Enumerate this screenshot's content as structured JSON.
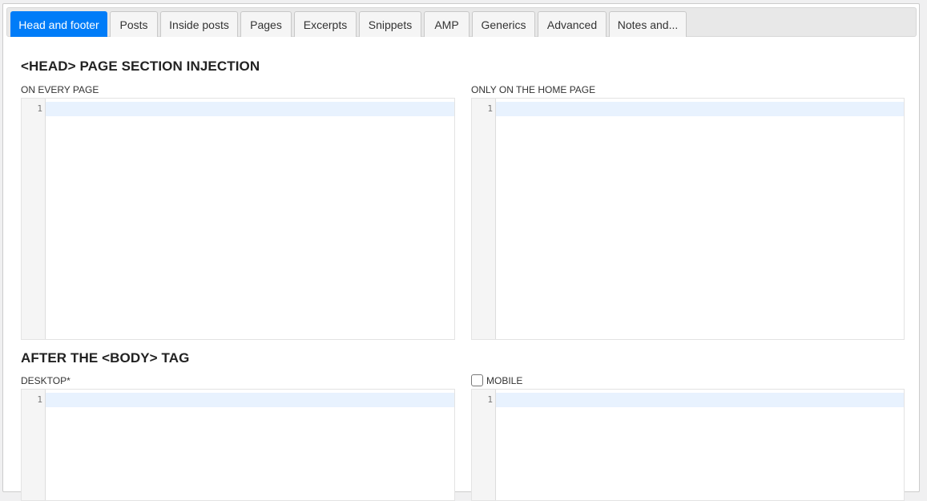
{
  "tabs": [
    {
      "label": "Head and footer",
      "active": true
    },
    {
      "label": "Posts",
      "active": false
    },
    {
      "label": "Inside posts",
      "active": false
    },
    {
      "label": "Pages",
      "active": false
    },
    {
      "label": "Excerpts",
      "active": false
    },
    {
      "label": "Snippets",
      "active": false
    },
    {
      "label": "AMP",
      "active": false
    },
    {
      "label": "Generics",
      "active": false
    },
    {
      "label": "Advanced",
      "active": false
    },
    {
      "label": "Notes and...",
      "active": false
    }
  ],
  "colors": {
    "accent": "#007cf8",
    "active_line": "#e8f2fe",
    "gutter": "#f5f5f5"
  },
  "head_section": {
    "title": "<HEAD> PAGE SECTION INJECTION",
    "every_page": {
      "label": "ON EVERY PAGE",
      "line_number": "1",
      "value": ""
    },
    "home_page": {
      "label": "ONLY ON THE HOME PAGE",
      "line_number": "1",
      "value": ""
    }
  },
  "body_section": {
    "title": "AFTER THE <BODY> TAG",
    "desktop": {
      "label": "DESKTOP*",
      "line_number": "1",
      "value": ""
    },
    "mobile": {
      "label": "MOBILE",
      "checked": false,
      "line_number": "1",
      "value": ""
    }
  }
}
